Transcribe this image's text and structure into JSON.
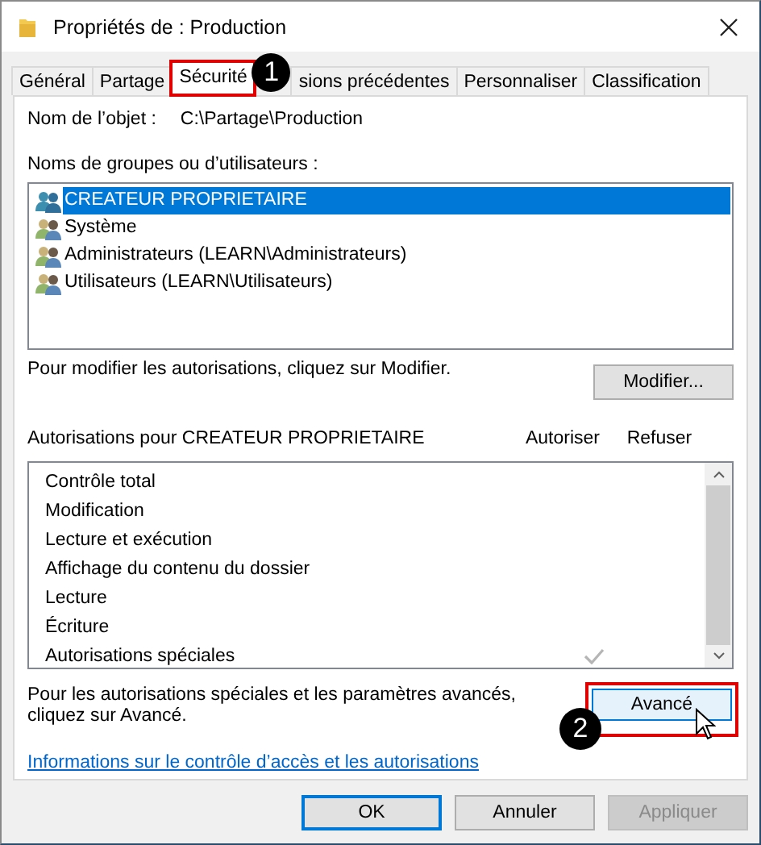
{
  "window": {
    "title": "Propriétés de : Production"
  },
  "tabs": [
    {
      "label": "Général",
      "selected": false,
      "highlighted": false
    },
    {
      "label": "Partage",
      "selected": false,
      "highlighted": false
    },
    {
      "label": "Sécurité",
      "selected": true,
      "highlighted": true
    },
    {
      "label": "sions précédentes",
      "selected": false,
      "highlighted": false
    },
    {
      "label": "Personnaliser",
      "selected": false,
      "highlighted": false
    },
    {
      "label": "Classification",
      "selected": false,
      "highlighted": false
    }
  ],
  "badges": [
    {
      "number": "1"
    },
    {
      "number": "2"
    }
  ],
  "object_name": {
    "label": "Nom de l’objet :",
    "value": "C:\\Partage\\Production"
  },
  "groups": {
    "label": "Noms de groupes ou d’utilisateurs :",
    "items": [
      {
        "name": "CREATEUR PROPRIETAIRE",
        "selected": true
      },
      {
        "name": "Système",
        "selected": false
      },
      {
        "name": "Administrateurs (LEARN\\Administrateurs)",
        "selected": false
      },
      {
        "name": "Utilisateurs (LEARN\\Utilisateurs)",
        "selected": false
      }
    ]
  },
  "modify": {
    "hint": "Pour modifier les autorisations, cliquez sur Modifier.",
    "button": "Modifier..."
  },
  "permissions": {
    "title": "Autorisations pour CREATEUR PROPRIETAIRE",
    "allow_header": "Autoriser",
    "deny_header": "Refuser",
    "items": [
      {
        "name": "Contrôle total",
        "allow": false
      },
      {
        "name": "Modification",
        "allow": false
      },
      {
        "name": "Lecture et exécution",
        "allow": false
      },
      {
        "name": "Affichage du contenu du dossier",
        "allow": false
      },
      {
        "name": "Lecture",
        "allow": false
      },
      {
        "name": "Écriture",
        "allow": false
      },
      {
        "name": "Autorisations spéciales",
        "allow": true
      }
    ]
  },
  "advanced": {
    "hint": "Pour les autorisations spéciales et les paramètres avancés, cliquez sur Avancé.",
    "button": "Avancé",
    "highlighted": true
  },
  "link": "Informations sur le contrôle d’accès et les autorisations",
  "buttons": [
    {
      "label": "OK",
      "kind": "default"
    },
    {
      "label": "Annuler",
      "kind": "normal"
    },
    {
      "label": "Appliquer",
      "kind": "disabled"
    }
  ]
}
